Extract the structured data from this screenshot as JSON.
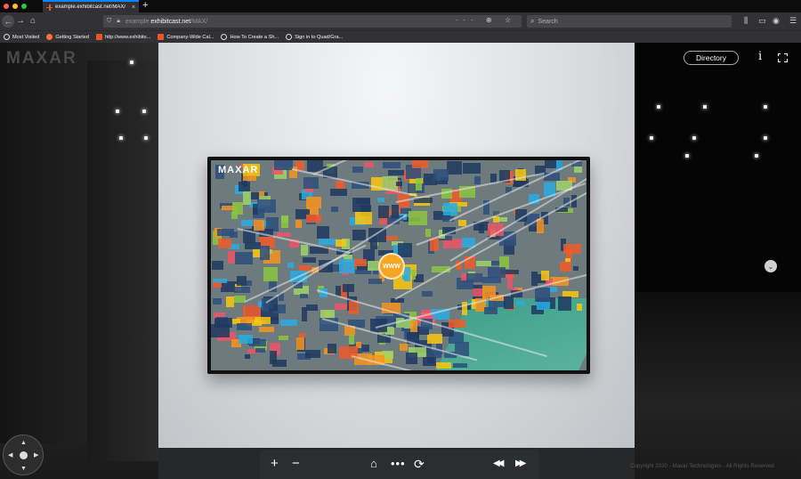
{
  "browser": {
    "tab_title": "example.exhibitcast.net/MAX/",
    "tab_close": "×",
    "new_tab": "+",
    "url_prefix": "example.",
    "url_host": "exhibitcast.net",
    "url_path": "/MAX/",
    "url_actions": "··· ⊕ ☆",
    "search_placeholder": "Search",
    "back": "←",
    "forward": "→",
    "home": "⌂",
    "menu": "☰"
  },
  "bookmarks": [
    {
      "label": "Most Visited",
      "icon": "gear-icon"
    },
    {
      "label": "Getting Started",
      "icon": "firefox-icon"
    },
    {
      "label": "http://www.exhibito...",
      "icon": "exhibitcast-icon"
    },
    {
      "label": "Company-Wide Cal...",
      "icon": "exhibitcast-icon"
    },
    {
      "label": "How To Create a Sh...",
      "icon": "globe-icon"
    },
    {
      "label": "Sign in to Quad/Gra...",
      "icon": "globe-icon"
    }
  ],
  "app": {
    "brand": "MAXAR",
    "screen_brand": "MAXAR",
    "directory_label": "Directory",
    "info_label": "i",
    "chevron": "⌄",
    "marker_label": "WWW",
    "copyright": "Copyright 2020 - Maxar Technologies - All Rights Reserved"
  },
  "controls": {
    "zoom_in": "+",
    "zoom_out": "−",
    "home": "⌂",
    "more": "•••",
    "refresh": "⟳",
    "prev": "◀◀",
    "next": "▶▶"
  },
  "dpad": {
    "up": "▲",
    "down": "▼",
    "left": "◀",
    "right": "▶"
  },
  "colors": {
    "accent": "#0a84ff",
    "marker": "#f5a623",
    "map_palette": [
      "#1f3a5f",
      "#2d4f7c",
      "#f7941d",
      "#f15a29",
      "#f9c80e",
      "#8cc63f",
      "#29abe2",
      "#ed5565",
      "#a0d468"
    ]
  }
}
